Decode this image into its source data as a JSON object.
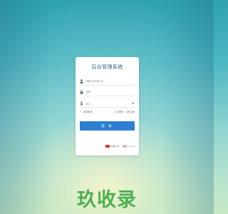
{
  "login": {
    "title": "后台管理系统",
    "username_placeholder": "邮箱/手机/用户名",
    "password_placeholder": "密码",
    "department_placeholder": "部门",
    "remember_label": "自动登录",
    "forgot_password_label": "忘记密码",
    "register_label": "立即注册",
    "submit_label": "登 录"
  },
  "language": {
    "chinese_label": "简体中文",
    "english_label": "English"
  },
  "watermark": {
    "text": "玖收录",
    "color": "#4caf50"
  },
  "colors": {
    "accent": "#2e7fd1",
    "card": "#ffffff",
    "title": "#2f5f7a"
  },
  "icons": {
    "username": "user-icon",
    "password": "lock-icon",
    "department": "person-icon",
    "dropdown": "caret-down-icon",
    "remember": "check-icon"
  }
}
